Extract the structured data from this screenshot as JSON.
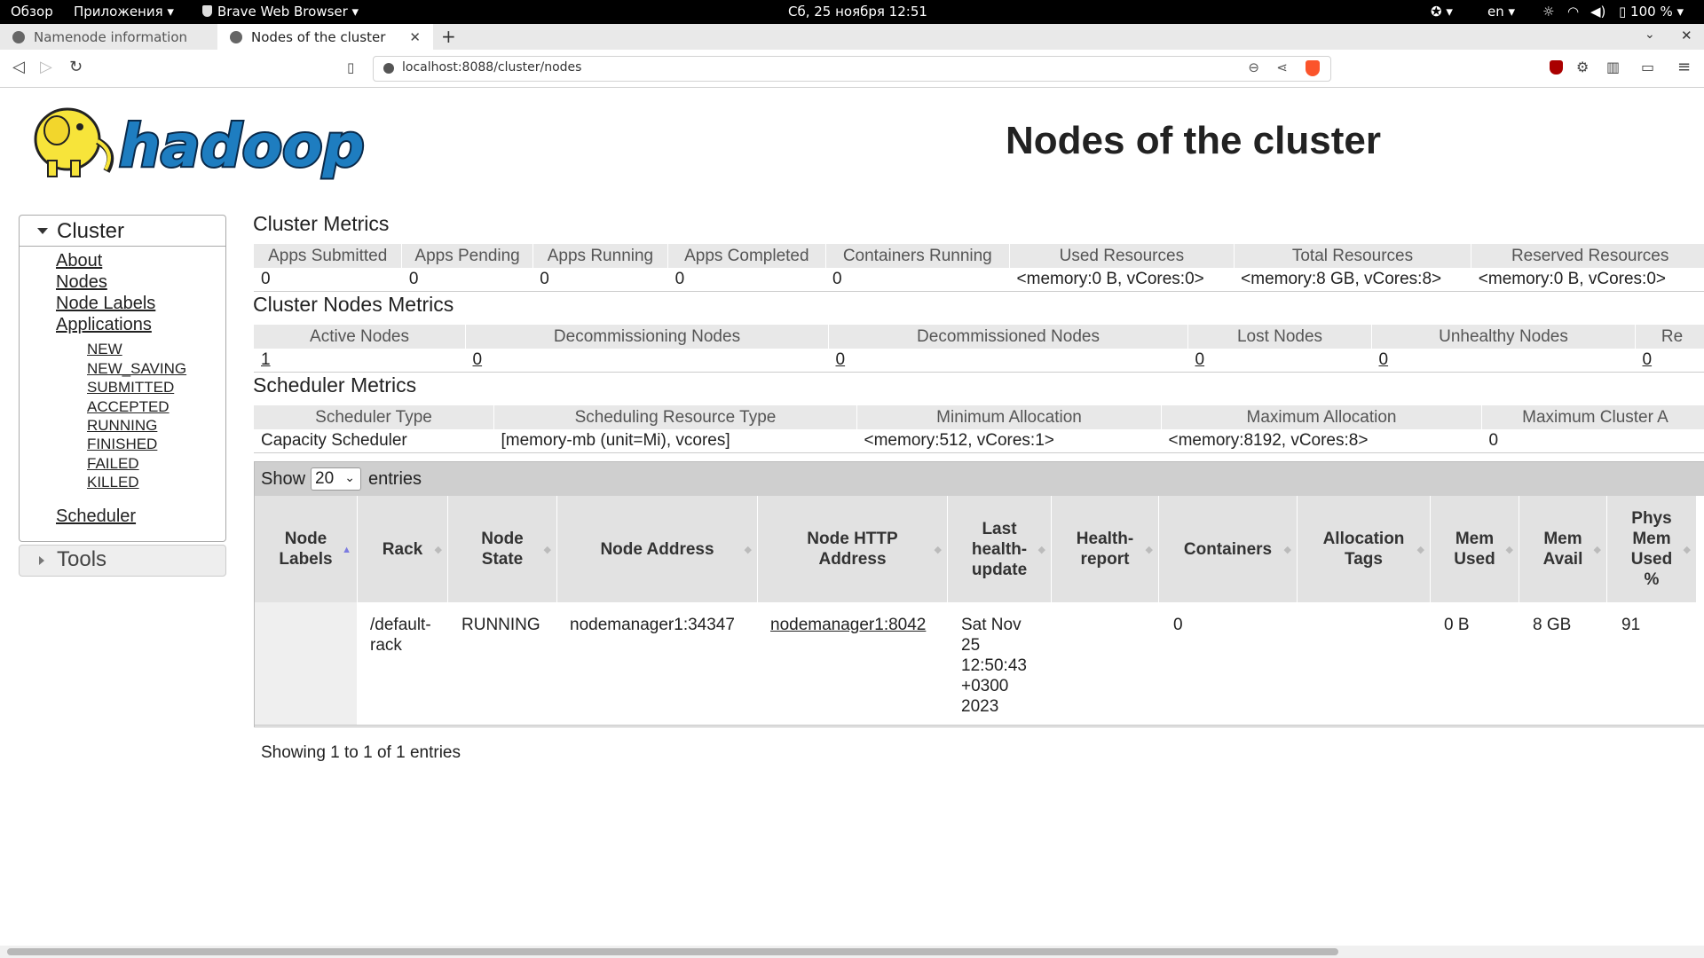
{
  "system_bar": {
    "activities": "Обзор",
    "apps": "Приложения",
    "browser_app": "Brave Web Browser",
    "clock": "Сб, 25 ноября  12:51",
    "lang": "en",
    "battery": "100 %"
  },
  "tabs": [
    {
      "title": "Namenode information"
    },
    {
      "title": "Nodes of the cluster"
    }
  ],
  "address_bar": {
    "url": "localhost:8088/cluster/nodes"
  },
  "page": {
    "title": "Nodes of the cluster",
    "logo_text": "hadoop"
  },
  "sidebar": {
    "cluster_label": "Cluster",
    "links": [
      "About",
      "Nodes",
      "Node Labels",
      "Applications"
    ],
    "app_states": [
      "NEW",
      "NEW_SAVING",
      "SUBMITTED",
      "ACCEPTED",
      "RUNNING",
      "FINISHED",
      "FAILED",
      "KILLED"
    ],
    "scheduler": "Scheduler",
    "tools_label": "Tools"
  },
  "cluster_metrics": {
    "title": "Cluster Metrics",
    "headers": [
      "Apps Submitted",
      "Apps Pending",
      "Apps Running",
      "Apps Completed",
      "Containers Running",
      "Used Resources",
      "Total Resources",
      "Reserved Resources"
    ],
    "values": [
      "0",
      "0",
      "0",
      "0",
      "0",
      "<memory:0 B, vCores:0>",
      "<memory:8 GB, vCores:8>",
      "<memory:0 B, vCores:0>"
    ]
  },
  "nodes_metrics": {
    "title": "Cluster Nodes Metrics",
    "headers": [
      "Active Nodes",
      "Decommissioning Nodes",
      "Decommissioned Nodes",
      "Lost Nodes",
      "Unhealthy Nodes",
      "Re"
    ],
    "values": [
      "1",
      "0",
      "0",
      "0",
      "0",
      "0"
    ]
  },
  "scheduler_metrics": {
    "title": "Scheduler Metrics",
    "headers": [
      "Scheduler Type",
      "Scheduling Resource Type",
      "Minimum Allocation",
      "Maximum Allocation",
      "Maximum Cluster A"
    ],
    "values": [
      "Capacity Scheduler",
      "[memory-mb (unit=Mi), vcores]",
      "<memory:512, vCores:1>",
      "<memory:8192, vCores:8>",
      "0"
    ]
  },
  "nodes_table": {
    "show_label": "Show",
    "page_size": "20",
    "entries_label": "entries",
    "headers": [
      "Node Labels",
      "Rack",
      "Node State",
      "Node Address",
      "Node HTTP Address",
      "Last health-update",
      "Health-report",
      "Containers",
      "Allocation Tags",
      "Mem Used",
      "Mem Avail",
      "Phys Mem Used %"
    ],
    "row": {
      "node_labels": "",
      "rack": "/default-rack",
      "state": "RUNNING",
      "address": "nodemanager1:34347",
      "http_address": "nodemanager1:8042",
      "last_health_update": "Sat Nov 25 12:50:43 +0300 2023",
      "health_report": "",
      "containers": "0",
      "allocation_tags": "",
      "mem_used": "0 B",
      "mem_avail": "8 GB",
      "phys_mem_used": "91"
    },
    "showing": "Showing 1 to 1 of 1 entries"
  }
}
